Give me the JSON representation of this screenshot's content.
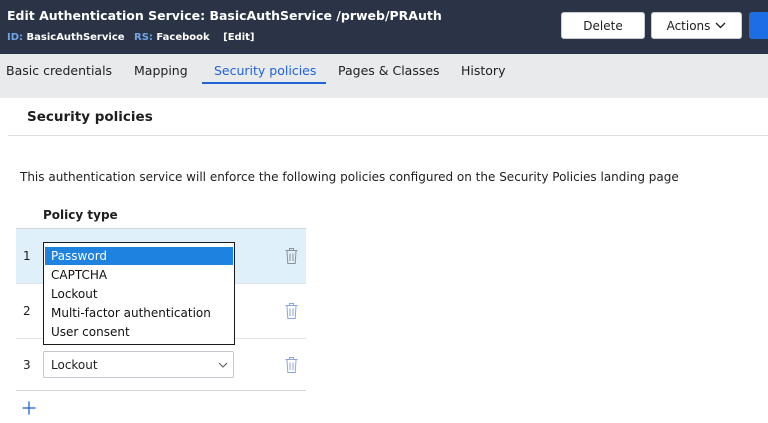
{
  "header": {
    "title": "Edit  Authentication Service: BasicAuthService /prweb/PRAuth",
    "id_key": "ID:",
    "id_value": "BasicAuthService",
    "rs_key": "RS:",
    "rs_value": "Facebook",
    "edit_label": "[Edit]",
    "delete_label": "Delete",
    "actions_label": "Actions"
  },
  "tabs": [
    {
      "label": "Basic credentials"
    },
    {
      "label": "Mapping"
    },
    {
      "label": "Security policies"
    },
    {
      "label": "Pages & Classes"
    },
    {
      "label": "History"
    }
  ],
  "active_tab": "Security policies",
  "panel": {
    "title": "Security policies",
    "description": "This authentication service will enforce the following policies configured on the Security Policies landing page",
    "column_header": "Policy type"
  },
  "rows": [
    {
      "number": "1",
      "value": "Password"
    },
    {
      "number": "2",
      "value": ""
    },
    {
      "number": "3",
      "value": "Lockout"
    }
  ],
  "dropdown": {
    "options": [
      "Password",
      "CAPTCHA",
      "Lockout",
      "Multi-factor authentication",
      "User consent"
    ],
    "selected": "Password"
  },
  "icons": {
    "trash": "trash-icon",
    "add": "plus-icon",
    "chevron": "chevron-down-icon"
  },
  "colors": {
    "header_bg": "#2b3447",
    "accent": "#2063d6",
    "selected_row": "#dff0fb",
    "dropdown_selected": "#1e82e0",
    "primary_button": "#1d6ee5"
  }
}
